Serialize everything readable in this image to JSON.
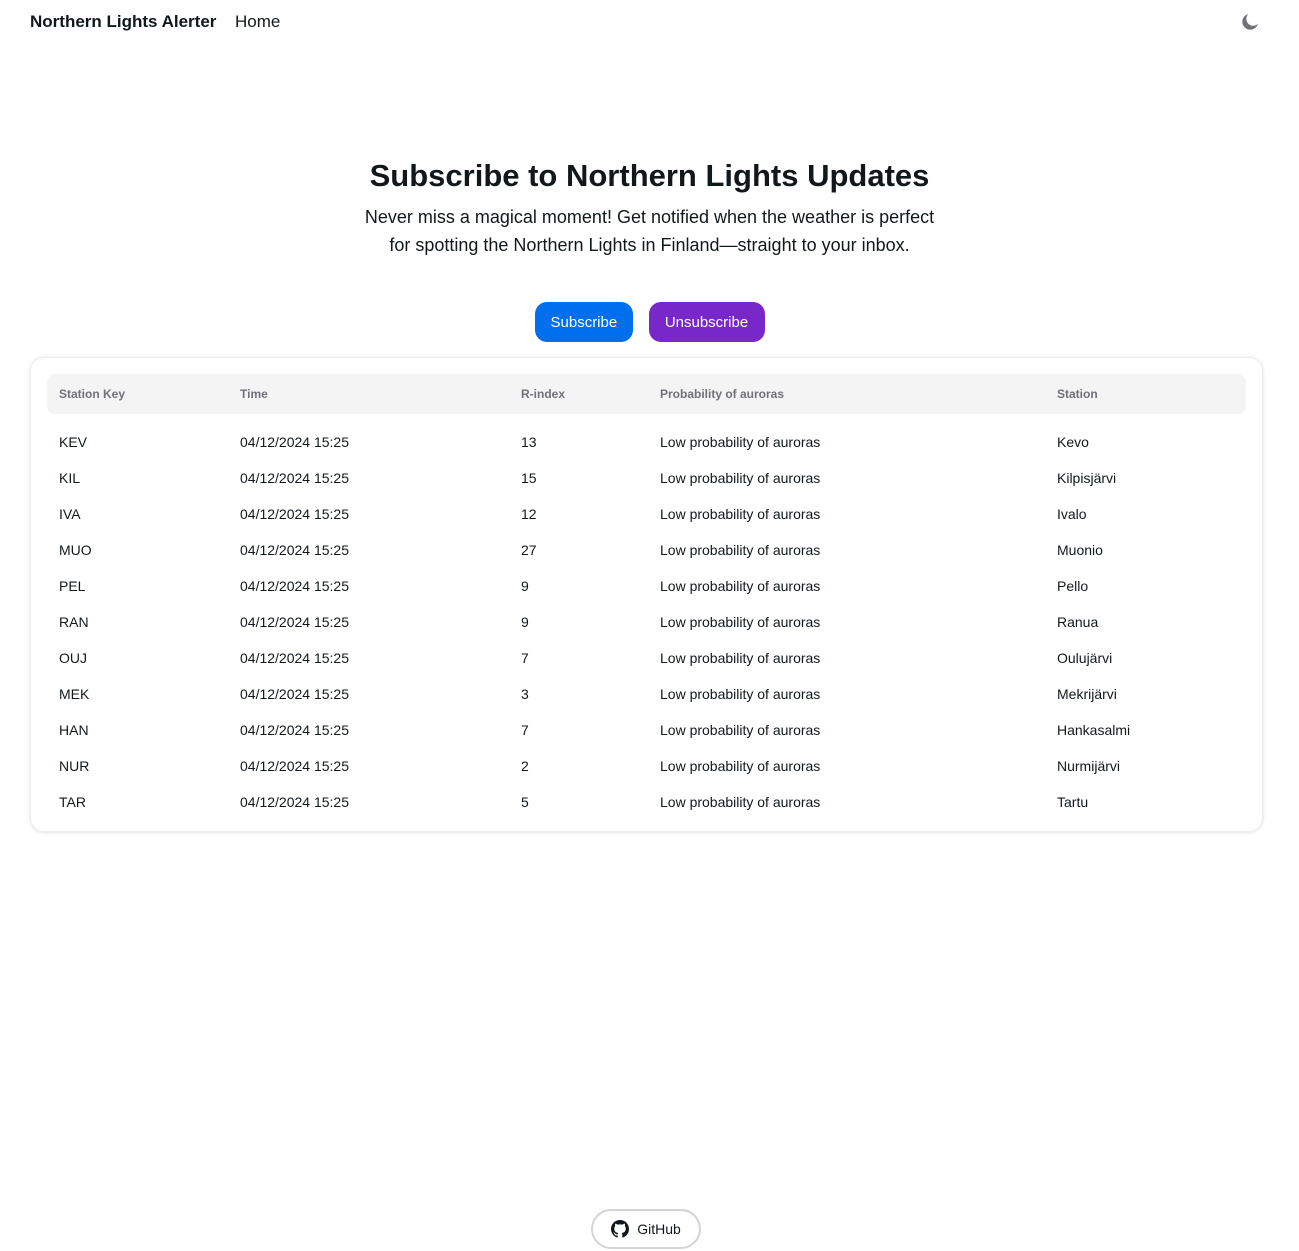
{
  "nav": {
    "brand": "Northern Lights Alerter",
    "home": "Home",
    "theme_icon": "moon-icon"
  },
  "hero": {
    "title": "Subscribe to Northern Lights Updates",
    "description": "Never miss a magical moment! Get notified when the weather is perfect for spotting the Northern Lights in Finland—straight to your inbox.",
    "subscribe_label": "Subscribe",
    "unsubscribe_label": "Unsubscribe"
  },
  "colors": {
    "primary": "#006fee",
    "secondary": "#7828c8"
  },
  "table": {
    "headers": [
      "Station Key",
      "Time",
      "R-index",
      "Probability of auroras",
      "Station"
    ],
    "rows": [
      [
        "KEV",
        "04/12/2024 15:25",
        "13",
        "Low probability of auroras",
        "Kevo"
      ],
      [
        "KIL",
        "04/12/2024 15:25",
        "15",
        "Low probability of auroras",
        "Kilpisjärvi"
      ],
      [
        "IVA",
        "04/12/2024 15:25",
        "12",
        "Low probability of auroras",
        "Ivalo"
      ],
      [
        "MUO",
        "04/12/2024 15:25",
        "27",
        "Low probability of auroras",
        "Muonio"
      ],
      [
        "PEL",
        "04/12/2024 15:25",
        "9",
        "Low probability of auroras",
        "Pello"
      ],
      [
        "RAN",
        "04/12/2024 15:25",
        "9",
        "Low probability of auroras",
        "Ranua"
      ],
      [
        "OUJ",
        "04/12/2024 15:25",
        "7",
        "Low probability of auroras",
        "Oulujärvi"
      ],
      [
        "MEK",
        "04/12/2024 15:25",
        "3",
        "Low probability of auroras",
        "Mekrijärvi"
      ],
      [
        "HAN",
        "04/12/2024 15:25",
        "7",
        "Low probability of auroras",
        "Hankasalmi"
      ],
      [
        "NUR",
        "04/12/2024 15:25",
        "2",
        "Low probability of auroras",
        "Nurmijärvi"
      ],
      [
        "TAR",
        "04/12/2024 15:25",
        "5",
        "Low probability of auroras",
        "Tartu"
      ]
    ]
  },
  "footer": {
    "github_label": "GitHub",
    "github_icon": "github-icon"
  }
}
